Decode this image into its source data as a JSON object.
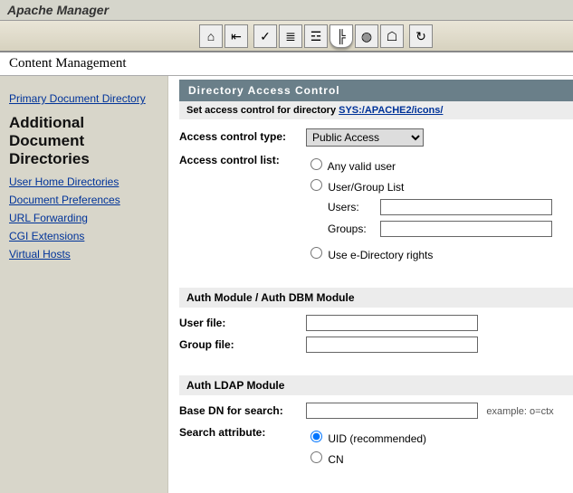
{
  "app_title": "Apache Manager",
  "breadcrumb": "Content Management",
  "toolbar_icons": [
    "home-icon",
    "exit-icon",
    "doc-check-icon",
    "doc-lines-icon",
    "doc-tree-icon",
    "tree-icon",
    "globe-icon",
    "server-icon",
    "refresh-icon"
  ],
  "sidebar": {
    "primary_link": "Primary Document Directory",
    "heading": "Additional Document Directories",
    "links": [
      "User Home Directories",
      "Document Preferences",
      "URL Forwarding",
      "CGI Extensions",
      "Virtual Hosts"
    ]
  },
  "panel_title": "Directory Access Control",
  "subhead_prefix": "Set access control for directory ",
  "subhead_link": "SYS:/APACHE2/icons/",
  "labels": {
    "ac_type": "Access control type:",
    "ac_list": "Access control list:",
    "users": "Users:",
    "groups": "Groups:",
    "any_valid": "Any valid user",
    "user_group": "User/Group List",
    "edir": "Use e-Directory rights",
    "auth_module": "Auth Module / Auth DBM Module",
    "user_file": "User file:",
    "group_file": "Group file:",
    "ldap_module": "Auth LDAP Module",
    "base_dn": "Base DN for search:",
    "search_attr": "Search attribute:",
    "uid": "UID (recommended)",
    "cn": "CN",
    "example": "example: o=ctx"
  },
  "ac_type_value": "Public Access",
  "fields": {
    "users": "",
    "groups": "",
    "user_file": "",
    "group_file": "",
    "base_dn": ""
  }
}
